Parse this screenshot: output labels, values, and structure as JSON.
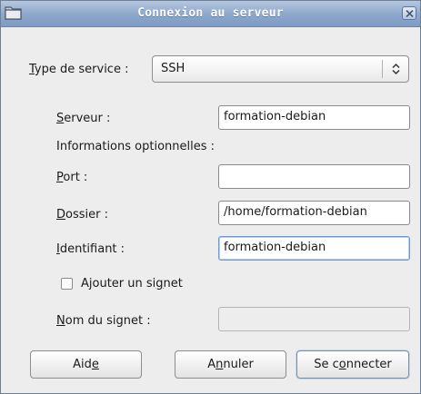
{
  "window": {
    "title": "Connexion au serveur",
    "icon": "folder-icon",
    "close_icon": "close-icon"
  },
  "service_type": {
    "label_mnemonic": "T",
    "label_rest": "ype de service :",
    "selected": "SSH"
  },
  "fields": {
    "server": {
      "mnemonic": "S",
      "rest": "erveur :",
      "value": "formation-debian"
    },
    "optional_header": "Informations optionnelles :",
    "port": {
      "mnemonic": "P",
      "rest": "ort :",
      "value": ""
    },
    "folder": {
      "mnemonic": "D",
      "rest": "ossier :",
      "value": "/home/formation-debian"
    },
    "user": {
      "mnemonic": "I",
      "rest": "dentifiant :",
      "value": "formation-debian"
    },
    "bookmark_check": {
      "before": "Ajouter un si",
      "mnemonic": "g",
      "after": "net",
      "checked": false
    },
    "bookmark_name": {
      "mnemonic": "N",
      "rest": "om du signet :",
      "value": ""
    }
  },
  "buttons": {
    "help": {
      "before": "Aid",
      "mnemonic": "e",
      "after": ""
    },
    "cancel": {
      "before": "A",
      "mnemonic": "n",
      "after": "nuler"
    },
    "connect": {
      "before": "Se c",
      "mnemonic": "o",
      "after": "nnecter"
    }
  }
}
